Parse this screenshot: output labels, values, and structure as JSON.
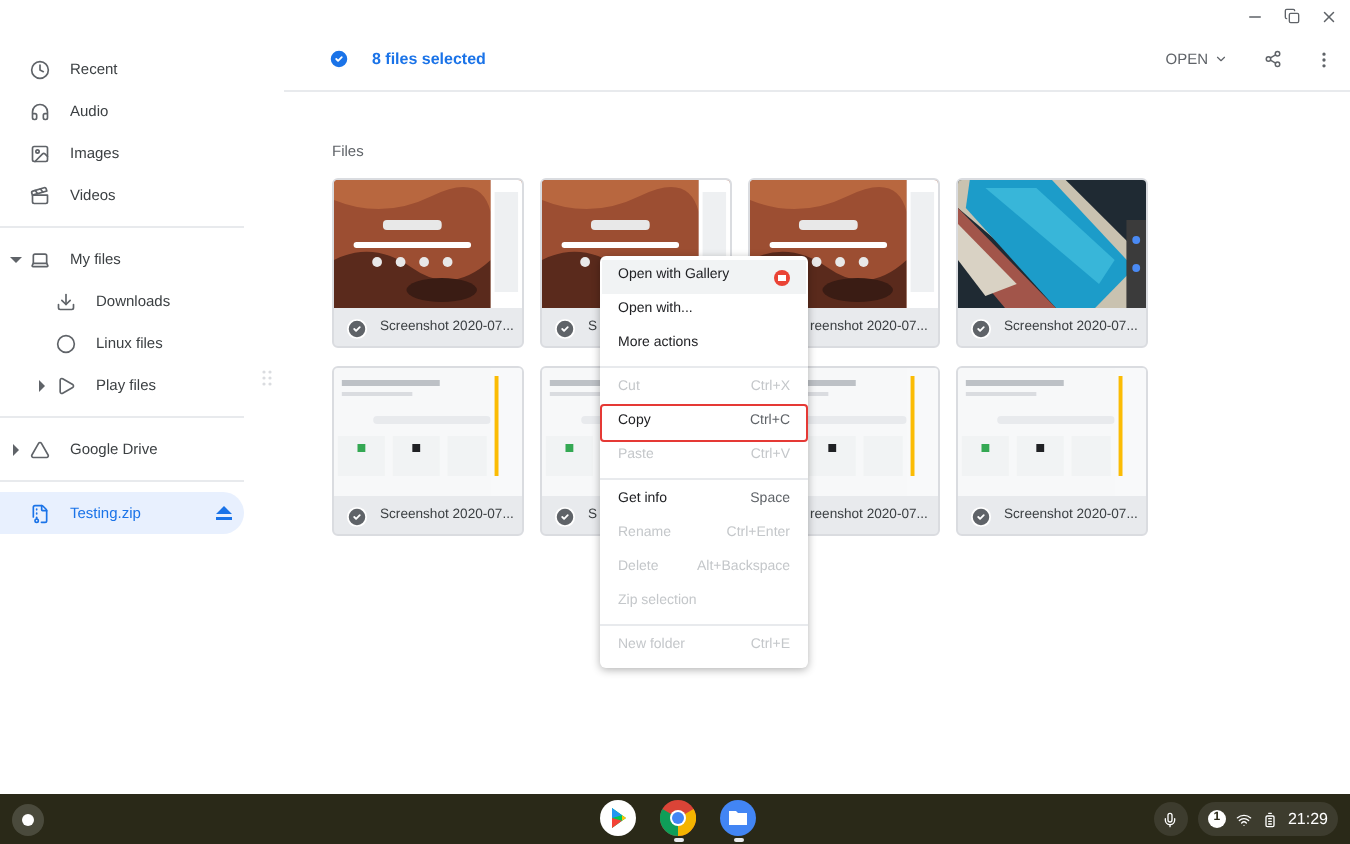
{
  "sidebar": {
    "items": [
      {
        "label": "Recent",
        "kind": "recent",
        "selected": false
      },
      {
        "label": "Audio",
        "kind": "audio",
        "selected": false
      },
      {
        "label": "Images",
        "kind": "images",
        "selected": false
      },
      {
        "label": "Videos",
        "kind": "videos",
        "selected": false
      },
      {
        "label": "My files",
        "kind": "laptop",
        "selected": false,
        "expanded": true,
        "divider_before": true,
        "children": [
          {
            "label": "Downloads",
            "kind": "download",
            "selected": false
          },
          {
            "label": "Linux files",
            "kind": "linux",
            "selected": false
          },
          {
            "label": "Play files",
            "kind": "play",
            "selected": false,
            "expanded": false
          }
        ]
      },
      {
        "label": "Google Drive",
        "kind": "drive",
        "selected": false,
        "expanded": false,
        "divider_before": true
      },
      {
        "label": "Testing.zip",
        "kind": "zip",
        "selected": true,
        "divider_before": true,
        "ejectable": true
      }
    ]
  },
  "header": {
    "selection": "8 files selected",
    "open_button": "OPEN"
  },
  "section_title": "Files",
  "files": [
    {
      "label": "Screenshot 2020-07...",
      "selected": true,
      "check_covered": false
    },
    {
      "label": "S",
      "selected": true,
      "check_covered": false
    },
    {
      "label": "reenshot 2020-07...",
      "selected": true,
      "check_covered": true
    },
    {
      "label": "Screenshot 2020-07...",
      "selected": true,
      "check_covered": false
    },
    {
      "label": "Screenshot 2020-07...",
      "selected": true,
      "check_covered": false
    },
    {
      "label": "S",
      "selected": true,
      "check_covered": false
    },
    {
      "label": "reenshot 2020-07...",
      "selected": true,
      "check_covered": true
    },
    {
      "label": "Screenshot 2020-07...",
      "selected": true,
      "check_covered": false
    }
  ],
  "context_menu": {
    "groups": [
      [
        {
          "label": "Open with Gallery",
          "disabled": false,
          "hovered": true,
          "app_badge": true
        },
        {
          "label": "Open with...",
          "disabled": false,
          "hovered": false
        },
        {
          "label": "More actions",
          "disabled": false,
          "hovered": false
        }
      ],
      [
        {
          "label": "Cut",
          "shortcut": "Ctrl+X",
          "disabled": true,
          "hovered": false
        },
        {
          "label": "Copy",
          "shortcut": "Ctrl+C",
          "disabled": false,
          "hovered": false,
          "outlined": true
        },
        {
          "label": "Paste",
          "shortcut": "Ctrl+V",
          "disabled": true,
          "hovered": false
        }
      ],
      [
        {
          "label": "Get info",
          "shortcut": "Space",
          "disabled": false,
          "hovered": false
        },
        {
          "label": "Rename",
          "shortcut": "Ctrl+Enter",
          "disabled": true,
          "hovered": false
        },
        {
          "label": "Delete",
          "shortcut": "Alt+Backspace",
          "disabled": true,
          "hovered": false
        },
        {
          "label": "Zip selection",
          "disabled": true,
          "hovered": false
        }
      ],
      [
        {
          "label": "New folder",
          "shortcut": "Ctrl+E",
          "disabled": true,
          "hovered": false
        }
      ]
    ]
  },
  "shelf": {
    "apps": [
      {
        "kind": "play",
        "running": false
      },
      {
        "kind": "chrome",
        "running": true
      },
      {
        "kind": "files",
        "running": true
      }
    ],
    "notification_count": "1",
    "time": "21:29"
  }
}
